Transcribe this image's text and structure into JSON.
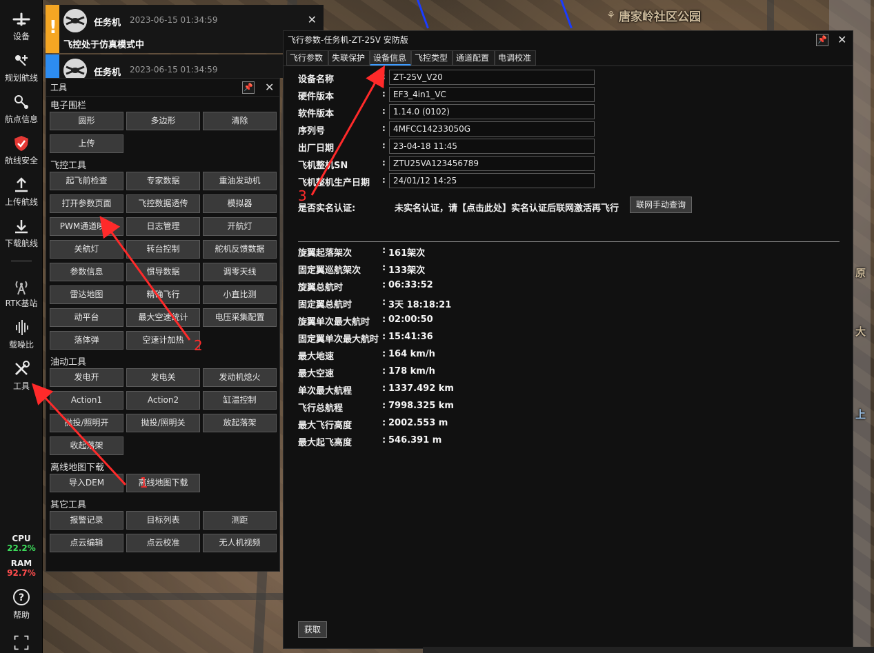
{
  "map": {
    "labels": [
      "唐家岭社区公园",
      "原",
      "大",
      "上"
    ]
  },
  "sidebar": {
    "items": [
      {
        "label": "设备",
        "icon": "plane-icon"
      },
      {
        "label": "规划航线",
        "icon": "route-plan-icon"
      },
      {
        "label": "航点信息",
        "icon": "waypoint-icon"
      },
      {
        "label": "航线安全",
        "icon": "shield-icon"
      },
      {
        "label": "上传航线",
        "icon": "upload-icon"
      },
      {
        "label": "下载航线",
        "icon": "download-icon"
      },
      {
        "label": "RTK基站",
        "icon": "antenna-icon"
      },
      {
        "label": "载噪比",
        "icon": "signal-bars-icon"
      },
      {
        "label": "工具",
        "icon": "tools-icon"
      },
      {
        "label": "帮助",
        "icon": "help-icon"
      }
    ],
    "cpu_label": "CPU",
    "cpu_value": "22.2%",
    "ram_label": "RAM",
    "ram_value": "92.7%"
  },
  "notifications": [
    {
      "name": "任务机",
      "time": "2023-06-15 01:34:59",
      "message": "飞控处于仿真模式中",
      "level": "warning",
      "color": "#f5a623"
    },
    {
      "name": "任务机",
      "time": "2023-06-15 01:34:59",
      "message": "",
      "level": "info",
      "color": "#2d8cf0"
    }
  ],
  "tools": {
    "title": "工具",
    "sections": [
      {
        "title": "电子围栏",
        "buttons": [
          "圆形",
          "多边形",
          "清除",
          "上传"
        ]
      },
      {
        "title": "飞控工具",
        "buttons": [
          "起飞前检查",
          "专家数据",
          "重油发动机",
          "打开参数页面",
          "飞控数据透传",
          "模拟器",
          "PWM通道映射",
          "日志管理",
          "开航灯",
          "关航灯",
          "转台控制",
          "舵机反馈数据",
          "参数信息",
          "惯导数据",
          "调零天线",
          "雷达地图",
          "精确飞行",
          "小直比测",
          "动平台",
          "最大空速统计",
          "电压采集配置",
          "落体弹",
          "空速计加热"
        ]
      },
      {
        "title": "油动工具",
        "buttons": [
          "发电开",
          "发电关",
          "发动机熄火",
          "Action1",
          "Action2",
          "缸温控制",
          "抛投/照明开",
          "抛投/照明关",
          "放起落架",
          "收起落架"
        ]
      },
      {
        "title": "离线地图下载",
        "buttons": [
          "导入DEM",
          "离线地图下载"
        ]
      },
      {
        "title": "其它工具",
        "buttons": [
          "报警记录",
          "目标列表",
          "测距",
          "点云编辑",
          "点云校准",
          "无人机视频"
        ]
      }
    ]
  },
  "params": {
    "title": "飞行参数-任务机-ZT-25V 安防版",
    "tabs": [
      "飞行参数",
      "失联保护",
      "设备信息",
      "飞控类型",
      "通道配置",
      "电调校准"
    ],
    "active_tab": "设备信息",
    "fields": [
      {
        "label": "设备名称",
        "value": "ZT-25V_V20"
      },
      {
        "label": "硬件版本",
        "value": "EF3_4in1_VC"
      },
      {
        "label": "软件版本",
        "value": "1.14.0 (0102)"
      },
      {
        "label": "序列号",
        "value": "4MFCC14233050G"
      },
      {
        "label": "出厂日期",
        "value": "23-04-18 11:45"
      },
      {
        "label": "飞机整机SN",
        "value": "ZTU25VA123456789"
      },
      {
        "label": "飞机整机生产日期",
        "value": "24/01/12 14:25"
      }
    ],
    "realname_label": "是否实名认证:",
    "realname_text": "未实名认证，请【点击此处】实名认证后联网激活再飞行",
    "realname_button": "联网手动查询",
    "stats": [
      {
        "label": "旋翼起落架次",
        "value": "161架次"
      },
      {
        "label": "固定翼巡航架次",
        "value": "133架次"
      },
      {
        "label": "旋翼总航时",
        "value": "06:33:52"
      },
      {
        "label": "固定翼总航时",
        "value": "3天 18:18:21"
      },
      {
        "label": "旋翼单次最大航时",
        "value": "02:00:50"
      },
      {
        "label": "固定翼单次最大航时",
        "value": "15:41:36"
      },
      {
        "label": "最大地速",
        "value": "164 km/h"
      },
      {
        "label": "最大空速",
        "value": "178 km/h"
      },
      {
        "label": "单次最大航程",
        "value": "1337.492 km"
      },
      {
        "label": "飞行总航程",
        "value": "7998.325 km"
      },
      {
        "label": "最大飞行高度",
        "value": "2002.553 m"
      },
      {
        "label": "最大起飞高度",
        "value": "546.391 m"
      }
    ],
    "fetch_button": "获取"
  },
  "annotations": {
    "numbers": [
      "1",
      "2",
      "3"
    ],
    "color": "#ff2a2a"
  }
}
